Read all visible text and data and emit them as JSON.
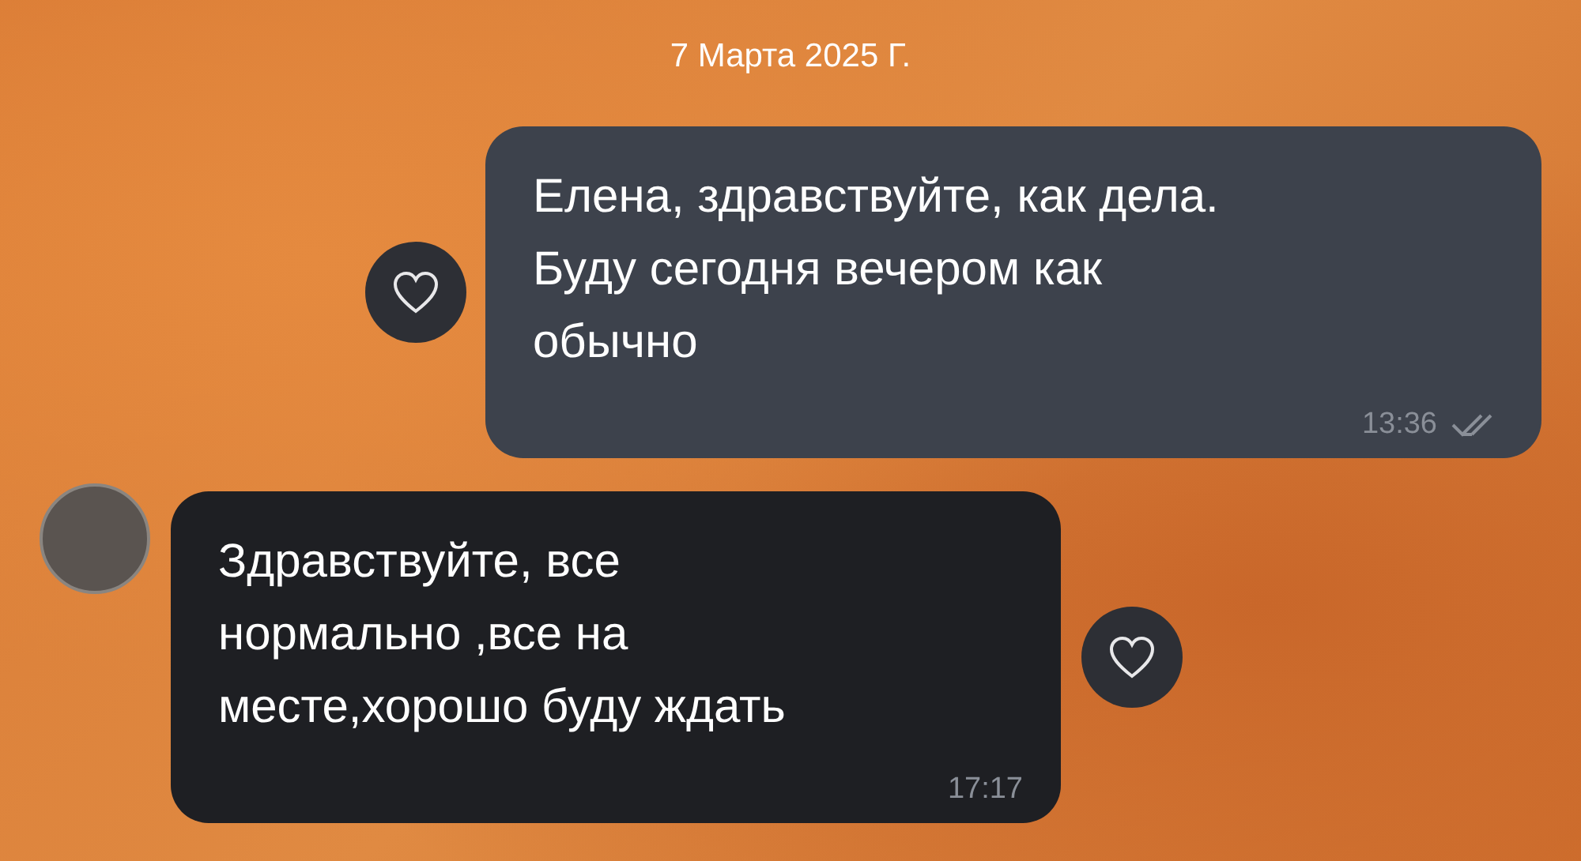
{
  "date_separator": "7 Марта 2025 Г.",
  "messages": [
    {
      "kind": "outgoing",
      "text": "Елена, здравствуйте, как дела.\nБуду сегодня вечером как\nобычно",
      "time": "13:36",
      "read": true
    },
    {
      "kind": "incoming",
      "text": "Здравствуйте, все\nнормально ,все на\nместе,хорошо буду ждать",
      "time": "17:17"
    }
  ]
}
